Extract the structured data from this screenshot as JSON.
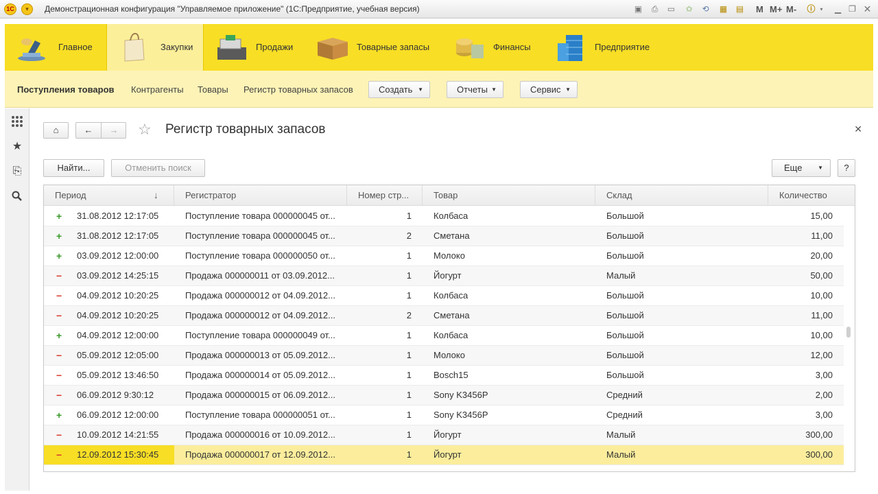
{
  "window": {
    "title": "Демонстрационная конфигурация \"Управляемое приложение\" (1С:Предприятие, учебная версия)",
    "logo": "1С",
    "m_labels": [
      "M",
      "M+",
      "M-"
    ]
  },
  "sections": [
    {
      "label": "Главное",
      "icon": "desk-lamp-icon"
    },
    {
      "label": "Закупки",
      "icon": "shopping-bag-icon"
    },
    {
      "label": "Продажи",
      "icon": "cash-register-icon"
    },
    {
      "label": "Товарные запасы",
      "icon": "box-icon"
    },
    {
      "label": "Финансы",
      "icon": "coins-icon"
    },
    {
      "label": "Предприятие",
      "icon": "building-icon"
    }
  ],
  "navpanel": {
    "links": [
      "Поступления товаров",
      "Контрагенты",
      "Товары",
      "Регистр товарных запасов"
    ],
    "dropdowns": [
      "Создать",
      "Отчеты",
      "Сервис"
    ]
  },
  "form": {
    "title": "Регистр товарных запасов",
    "find_label": "Найти...",
    "cancel_search_label": "Отменить поиск",
    "more_label": "Еще",
    "help_label": "?"
  },
  "table": {
    "columns": [
      "Период",
      "Регистратор",
      "Номер стр...",
      "Товар",
      "Склад",
      "Количество"
    ],
    "rows": [
      {
        "sign": "+",
        "period": "31.08.2012 12:17:05",
        "registrar": "Поступление товара 000000045 от...",
        "line": "1",
        "item": "Колбаса",
        "warehouse": "Большой",
        "qty": "15,00"
      },
      {
        "sign": "+",
        "period": "31.08.2012 12:17:05",
        "registrar": "Поступление товара 000000045 от...",
        "line": "2",
        "item": "Сметана",
        "warehouse": "Большой",
        "qty": "11,00"
      },
      {
        "sign": "+",
        "period": "03.09.2012 12:00:00",
        "registrar": "Поступление товара 000000050 от...",
        "line": "1",
        "item": "Молоко",
        "warehouse": "Большой",
        "qty": "20,00"
      },
      {
        "sign": "−",
        "period": "03.09.2012 14:25:15",
        "registrar": "Продажа 000000011 от 03.09.2012...",
        "line": "1",
        "item": "Йогурт",
        "warehouse": "Малый",
        "qty": "50,00"
      },
      {
        "sign": "−",
        "period": "04.09.2012 10:20:25",
        "registrar": "Продажа 000000012 от 04.09.2012...",
        "line": "1",
        "item": "Колбаса",
        "warehouse": "Большой",
        "qty": "10,00"
      },
      {
        "sign": "−",
        "period": "04.09.2012 10:20:25",
        "registrar": "Продажа 000000012 от 04.09.2012...",
        "line": "2",
        "item": "Сметана",
        "warehouse": "Большой",
        "qty": "11,00"
      },
      {
        "sign": "+",
        "period": "04.09.2012 12:00:00",
        "registrar": "Поступление товара 000000049 от...",
        "line": "1",
        "item": "Колбаса",
        "warehouse": "Большой",
        "qty": "10,00"
      },
      {
        "sign": "−",
        "period": "05.09.2012 12:05:00",
        "registrar": "Продажа 000000013 от 05.09.2012...",
        "line": "1",
        "item": "Молоко",
        "warehouse": "Большой",
        "qty": "12,00"
      },
      {
        "sign": "−",
        "period": "05.09.2012 13:46:50",
        "registrar": "Продажа 000000014 от 05.09.2012...",
        "line": "1",
        "item": "Bosch15",
        "warehouse": "Большой",
        "qty": "3,00"
      },
      {
        "sign": "−",
        "period": "06.09.2012 9:30:12",
        "registrar": "Продажа 000000015 от 06.09.2012...",
        "line": "1",
        "item": "Sony K3456P",
        "warehouse": "Средний",
        "qty": "2,00"
      },
      {
        "sign": "+",
        "period": "06.09.2012 12:00:00",
        "registrar": "Поступление товара 000000051 от...",
        "line": "1",
        "item": "Sony K3456P",
        "warehouse": "Средний",
        "qty": "3,00"
      },
      {
        "sign": "−",
        "period": "10.09.2012 14:21:55",
        "registrar": "Продажа 000000016 от 10.09.2012...",
        "line": "1",
        "item": "Йогурт",
        "warehouse": "Малый",
        "qty": "300,00"
      },
      {
        "sign": "−",
        "period": "12.09.2012 15:30:45",
        "registrar": "Продажа 000000017 от 12.09.2012...",
        "line": "1",
        "item": "Йогурт",
        "warehouse": "Малый",
        "qty": "300,00"
      }
    ],
    "selected_row": 12
  },
  "colors": {
    "accent": "#f8de25",
    "section_active": "#fcef9a",
    "nav_background": "#fdf3b6",
    "plus": "#3a9a2a",
    "minus": "#d83b2e"
  }
}
